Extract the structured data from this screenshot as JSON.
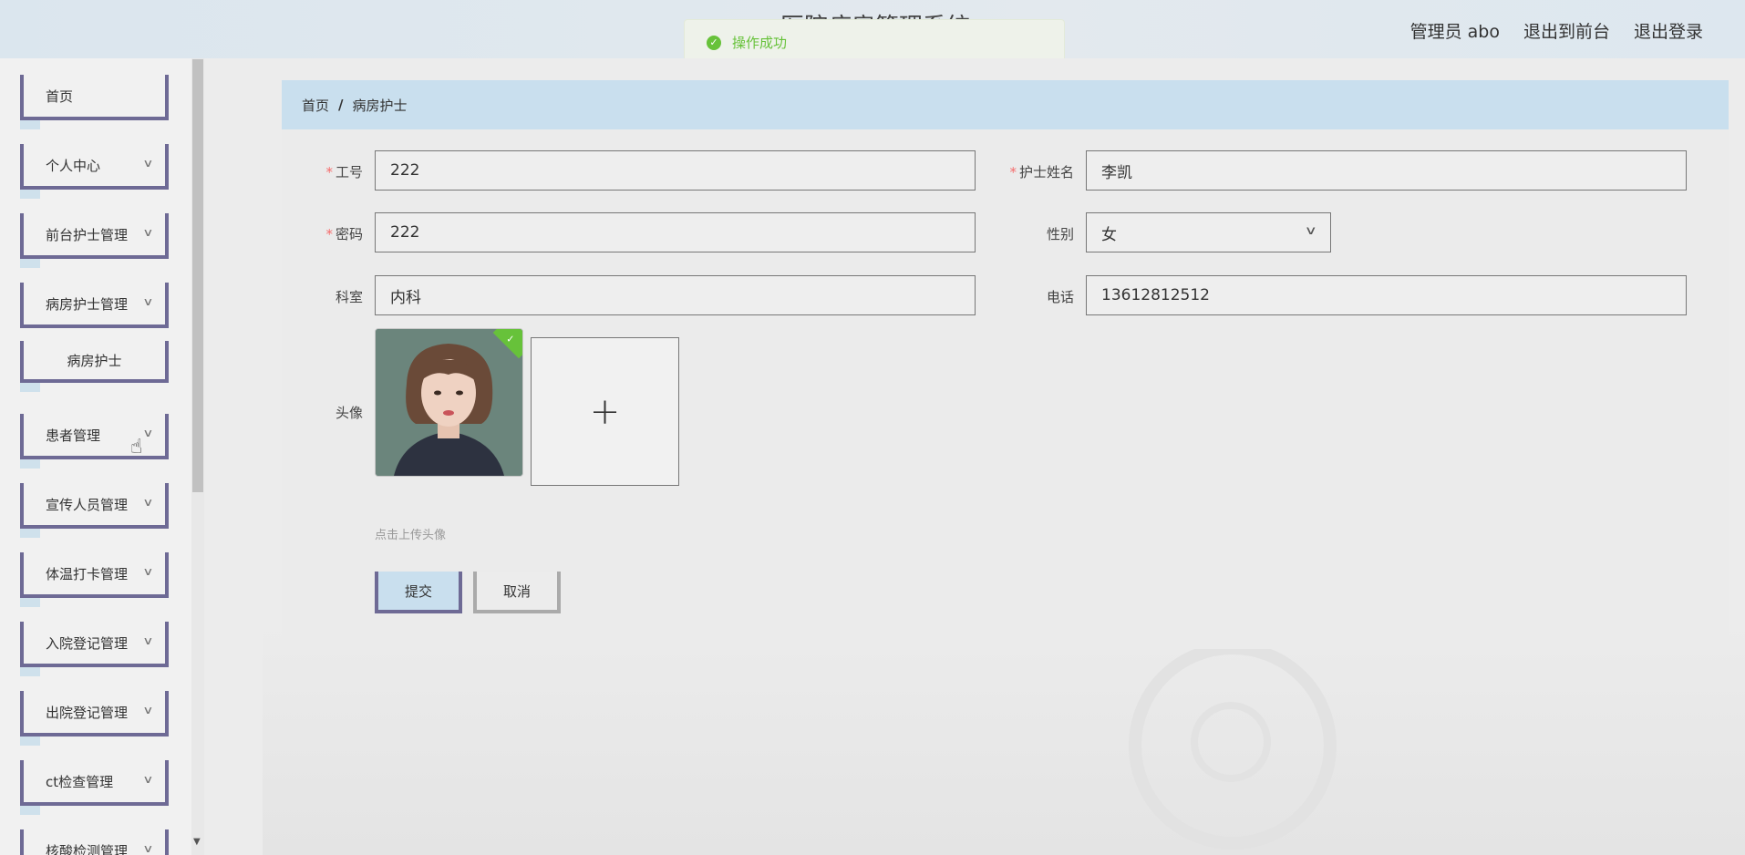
{
  "header": {
    "site_title": "医院病房管理系统",
    "links": [
      "管理员 abo",
      "退出到前台",
      "退出登录"
    ]
  },
  "toast": {
    "message": "操作成功"
  },
  "sidebar": {
    "items": [
      {
        "label": "首页"
      },
      {
        "label": "个人中心"
      },
      {
        "label": "前台护士管理"
      },
      {
        "label": "病房护士管理"
      },
      {
        "label": "病房护士"
      },
      {
        "label": "患者管理"
      },
      {
        "label": "宣传人员管理"
      },
      {
        "label": "体温打卡管理"
      },
      {
        "label": "入院登记管理"
      },
      {
        "label": "出院登记管理"
      },
      {
        "label": "ct检查管理"
      },
      {
        "label": "核酸检测管理"
      }
    ]
  },
  "breadcrumb": {
    "home": "首页",
    "sep": "/",
    "current": "病房护士"
  },
  "form": {
    "employee_id": {
      "label": "工号",
      "value": "222"
    },
    "nurse_name": {
      "label": "护士姓名",
      "value": "李凯"
    },
    "password": {
      "label": "密码",
      "value": "222"
    },
    "gender": {
      "label": "性别",
      "value": "女"
    },
    "department": {
      "label": "科室",
      "value": "内科"
    },
    "phone": {
      "label": "电话",
      "value": "13612812512"
    },
    "avatar": {
      "label": "头像",
      "tip": "点击上传头像",
      "plus": "+"
    },
    "submit": "提交",
    "cancel": "取消"
  }
}
